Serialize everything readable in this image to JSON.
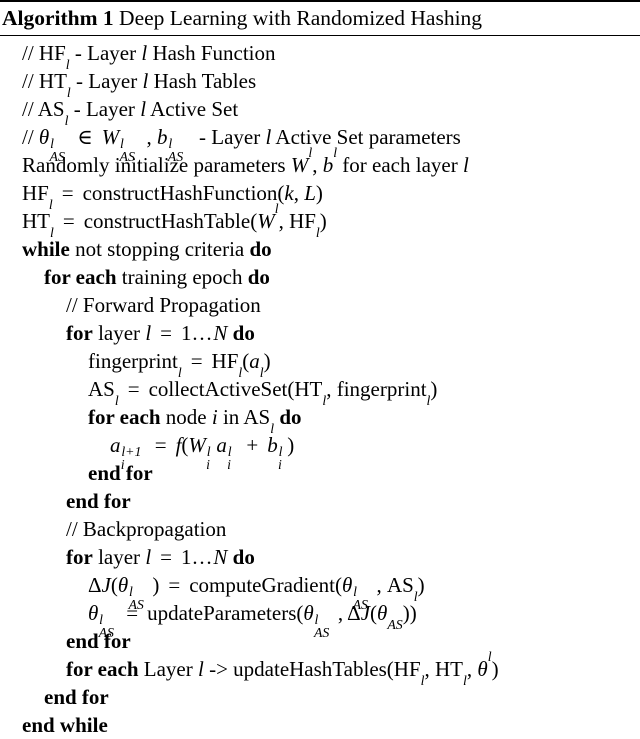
{
  "algorithm": {
    "label": "Algorithm 1",
    "title": "Deep Learning with Randomized Hashing",
    "lines": [
      {
        "id": "c1",
        "indent": 0,
        "text": "// HF_l - Layer l Hash Function"
      },
      {
        "id": "c2",
        "indent": 0,
        "text": "// HT_l - Layer l Hash Tables"
      },
      {
        "id": "c3",
        "indent": 0,
        "text": "// AS_l - Layer l Active Set"
      },
      {
        "id": "c4",
        "indent": 0,
        "text": "// θ^l_AS ∈ W^l_AS, b^l_AS - Layer l Active Set parameters"
      },
      {
        "id": "s1",
        "indent": 0,
        "text": "Randomly initialize parameters W^l, b^l for each layer l"
      },
      {
        "id": "s2",
        "indent": 0,
        "text": "HF_l = constructHashFunction(k, L)"
      },
      {
        "id": "s3",
        "indent": 0,
        "text": "HT_l = constructHashTable(W^l, HF_l)"
      },
      {
        "id": "s4",
        "indent": 0,
        "text": "while not stopping criteria do"
      },
      {
        "id": "s5",
        "indent": 1,
        "text": "for each training epoch do"
      },
      {
        "id": "c5",
        "indent": 2,
        "text": "// Forward Propagation"
      },
      {
        "id": "s6",
        "indent": 2,
        "text": "for layer l = 1…N do"
      },
      {
        "id": "s7",
        "indent": 3,
        "text": "fingerprint_l = HF_l(a_l)"
      },
      {
        "id": "s8",
        "indent": 3,
        "text": "AS_l = collectActiveSet(HT_l, fingerprint_l)"
      },
      {
        "id": "s9",
        "indent": 3,
        "text": "for each node i in AS_l do"
      },
      {
        "id": "s10",
        "indent": 4,
        "text": "a_i^{l+1} = f(W_i^l a_i^l + b_i^l)"
      },
      {
        "id": "s11",
        "indent": 3,
        "text": "end for"
      },
      {
        "id": "s12",
        "indent": 2,
        "text": "end for"
      },
      {
        "id": "c6",
        "indent": 2,
        "text": "// Backpropagation"
      },
      {
        "id": "s13",
        "indent": 2,
        "text": "for layer l = 1…N do"
      },
      {
        "id": "s14",
        "indent": 3,
        "text": "ΔJ(θ^l_AS) = computeGradient(θ^l_AS, AS_l)"
      },
      {
        "id": "s15",
        "indent": 3,
        "text": "θ^l_AS = updateParameters(θ^l_AS, ΔJ(θ_AS))"
      },
      {
        "id": "s16",
        "indent": 2,
        "text": "end for"
      },
      {
        "id": "s17",
        "indent": 2,
        "text": "for each Layer l -> updateHashTables(HF_l, HT_l, θ^l)"
      },
      {
        "id": "s18",
        "indent": 1,
        "text": "end for"
      },
      {
        "id": "s19",
        "indent": 0,
        "text": "end while"
      }
    ],
    "keywords": [
      "while",
      "do",
      "for",
      "for each",
      "end for",
      "end while"
    ]
  }
}
